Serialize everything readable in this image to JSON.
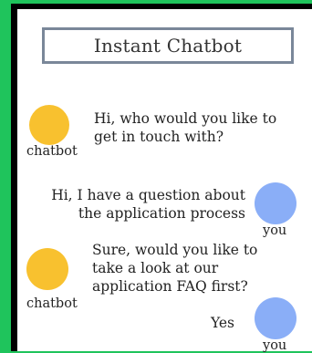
{
  "header": {
    "title": "Instant Chatbot"
  },
  "messages": [
    {
      "sender": "chatbot",
      "text_line1": "Hi, who would you like to",
      "text_line2": "get in touch with?"
    },
    {
      "sender": "you",
      "text_line1": "Hi, I have a question about",
      "text_line2": "the application process"
    },
    {
      "sender": "chatbot",
      "text_line1": "Sure, would you like to",
      "text_line2": "take a look at our",
      "text_line3": "application FAQ first?"
    },
    {
      "sender": "you",
      "text_line1": "Yes"
    }
  ],
  "labels": {
    "chatbot": "chatbot",
    "you": "you"
  },
  "colors": {
    "background": "#1fc45c",
    "bot_avatar": "#f8c12f",
    "user_avatar": "#8aaef7",
    "header_border": "#7a8799"
  }
}
